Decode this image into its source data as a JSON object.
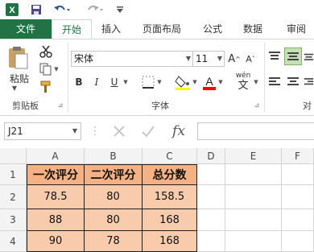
{
  "qat": {
    "icons": [
      "excel-logo",
      "save",
      "undo",
      "redo",
      "customize"
    ]
  },
  "tabs": [
    "文件",
    "开始",
    "插入",
    "页面布局",
    "公式",
    "数据",
    "审阅"
  ],
  "active_tab": "开始",
  "clipboard": {
    "paste_label": "粘贴",
    "group_label": "剪贴板"
  },
  "font": {
    "name": "宋体",
    "size": "11",
    "group_label": "字体",
    "bold": "B",
    "italic": "I",
    "underline": "U",
    "wen": "wén"
  },
  "alignment": {
    "group_label_partial": "对"
  },
  "formula_bar": {
    "name_box": "J21",
    "fx": "fx"
  },
  "grid": {
    "columns": [
      "A",
      "B",
      "C",
      "D",
      "E",
      "F"
    ],
    "rows": [
      "1",
      "2",
      "3",
      "4"
    ],
    "headers": [
      "一次评分",
      "二次评分",
      "总分数"
    ],
    "data": [
      [
        "78.5",
        "80",
        "158.5"
      ],
      [
        "88",
        "80",
        "168"
      ],
      [
        "90",
        "78",
        "168"
      ]
    ]
  },
  "colors": {
    "excel_green": "#217346",
    "header_fill": "#f4b183",
    "data_fill": "#f8cbad"
  }
}
